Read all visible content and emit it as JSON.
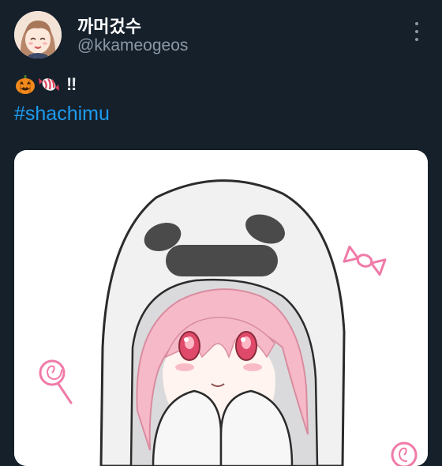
{
  "author": {
    "display_name": "까머겄수",
    "handle": "@kkameogeos",
    "avatar_icon": "anime-girl-avatar"
  },
  "menu": {
    "icon": "more-options-icon"
  },
  "tweet": {
    "emojis": [
      "jack-o-lantern-emoji",
      "candy-emoji"
    ],
    "exclaim": "‼",
    "hashtag": "#shachimu"
  },
  "media": {
    "subject": "illustration-ghost-costume-girl",
    "colors": {
      "background": "#ffffff",
      "hair": "#f6b9c8",
      "eyes": "#e04a6a",
      "candy": "#f07aa8",
      "outline": "#2b2b2b"
    }
  },
  "theme": {
    "background": "#15202b",
    "link": "#1d9bf0",
    "secondary_text": "#8b98a5"
  }
}
